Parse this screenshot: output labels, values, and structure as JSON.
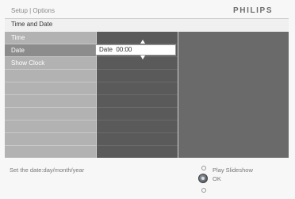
{
  "header": {
    "breadcrumb": "Setup | Options",
    "brand": "PHILIPS"
  },
  "title": "Time and Date",
  "menu": {
    "items": [
      "Time",
      "Date",
      "Show Clock"
    ],
    "selected_index": 1
  },
  "date_field": {
    "value": "Date  00:00"
  },
  "footer": {
    "hint": "Set the date:day/month/year",
    "play_label": "Play Slideshow",
    "ok_label": "OK"
  },
  "colors": {
    "panel": "#d2d2d2",
    "selected_row": "#8c8c8c",
    "dark_column": "#5a5a5a"
  }
}
